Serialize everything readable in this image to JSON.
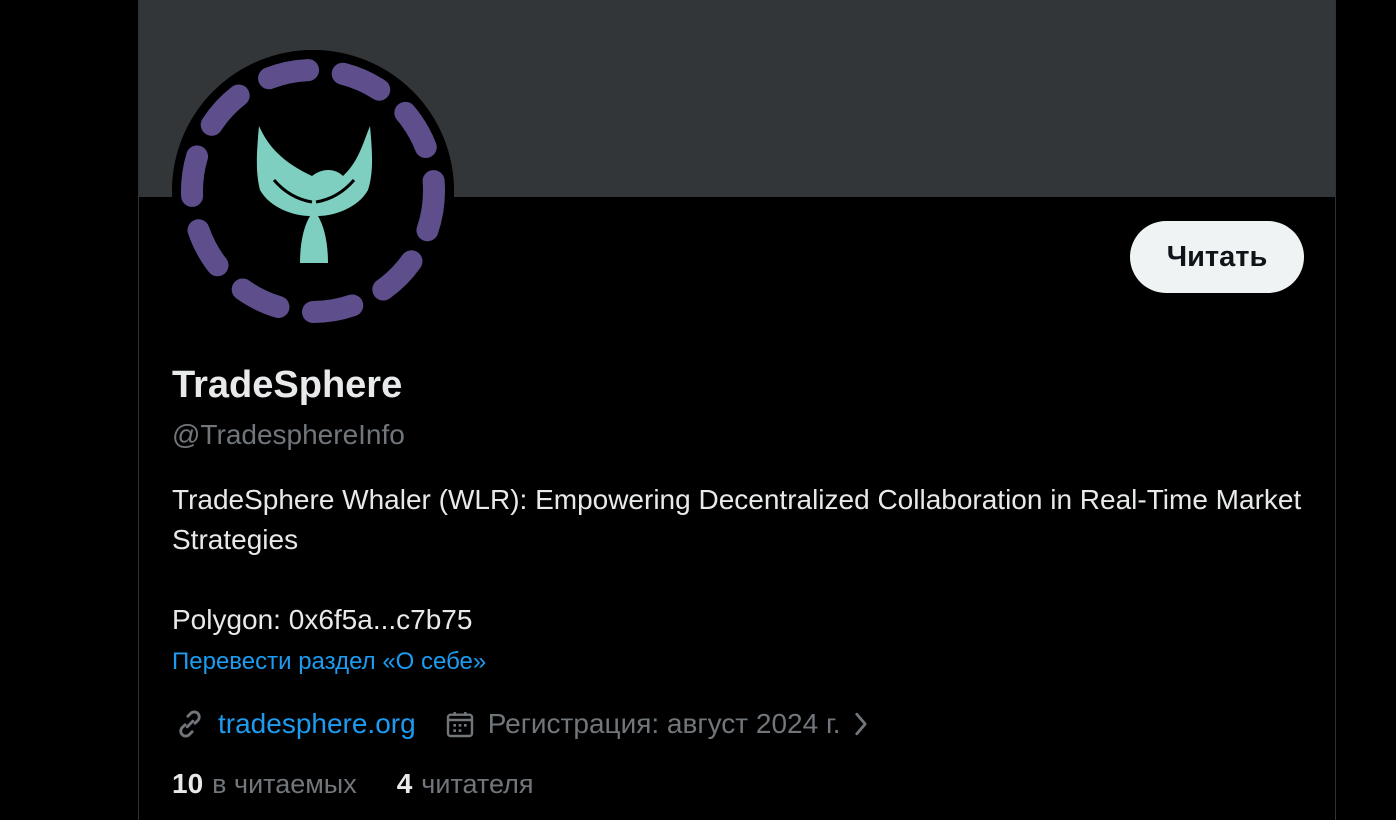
{
  "profile": {
    "display_name": "TradeSphere",
    "handle": "@TradesphereInfo",
    "follow_label": "Читать",
    "bio_line1": "TradeSphere Whaler (WLR): Empowering Decentralized Collaboration in Real-Time Market Strategies",
    "bio_line2": "Polygon: 0x6f5a...c7b75",
    "translate_label": "Перевести раздел «О себе»",
    "website": "tradesphere.org",
    "joined": "Регистрация: август 2024 г.",
    "following_count": "10",
    "following_label": "в читаемых",
    "followers_count": "4",
    "followers_label": "читателя"
  },
  "icons": {
    "avatar": "whale-tail-logo",
    "website": "link-icon",
    "joined": "calendar-icon",
    "more": "chevron-right-icon"
  },
  "colors": {
    "background": "#000000",
    "banner": "#333639",
    "accent_link": "#1d9bf0",
    "avatar_ring": "#5e4f8c",
    "avatar_tail": "#7ecfbf",
    "button_bg": "#eff3f4",
    "primary_text": "#e7e9ea",
    "secondary_text": "#71767b"
  }
}
